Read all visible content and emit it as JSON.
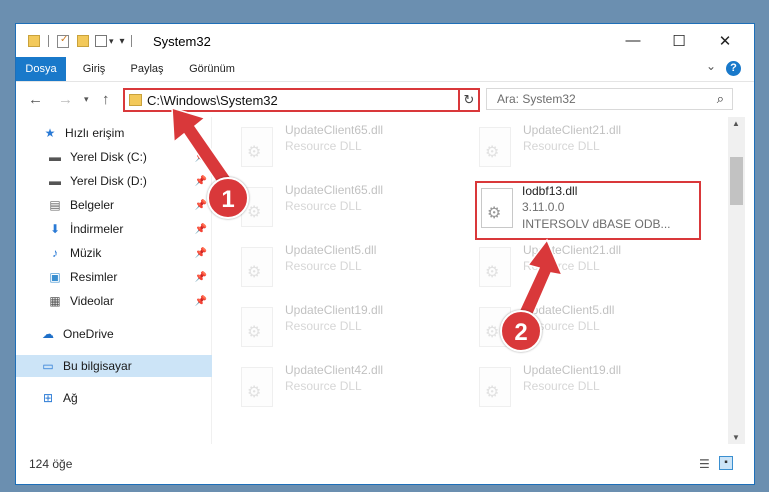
{
  "window": {
    "title": "System32",
    "minimize": "—",
    "maximize": "☐",
    "close": "✕"
  },
  "ribbon": {
    "tabs": [
      "Dosya",
      "Giriş",
      "Paylaş",
      "Görünüm"
    ],
    "collapse": "⌄",
    "help": "?"
  },
  "address": {
    "path": "C:\\Windows\\System32",
    "refresh": "↻",
    "search_placeholder": "Ara: System32"
  },
  "sidebar": {
    "items": [
      {
        "label": "Hızlı erişim",
        "icon": "star-icon",
        "glyph": "★",
        "pinned": false
      },
      {
        "label": "Yerel Disk (C:)",
        "icon": "drive-icon",
        "glyph": "▬",
        "pinned": true
      },
      {
        "label": "Yerel Disk (D:)",
        "icon": "drive-icon",
        "glyph": "▬",
        "pinned": true
      },
      {
        "label": "Belgeler",
        "icon": "document-icon",
        "glyph": "▤",
        "pinned": true
      },
      {
        "label": "İndirmeler",
        "icon": "download-icon",
        "glyph": "⬇",
        "pinned": true
      },
      {
        "label": "Müzik",
        "icon": "music-icon",
        "glyph": "♪",
        "pinned": true
      },
      {
        "label": "Resimler",
        "icon": "pictures-icon",
        "glyph": "▣",
        "pinned": true
      },
      {
        "label": "Videolar",
        "icon": "videos-icon",
        "glyph": "▦",
        "pinned": true
      },
      {
        "label": "OneDrive",
        "icon": "cloud-icon",
        "glyph": "☁",
        "pinned": false
      },
      {
        "label": "Bu bilgisayar",
        "icon": "computer-icon",
        "glyph": "▭",
        "pinned": false
      },
      {
        "label": "Ağ",
        "icon": "network-icon",
        "glyph": "⊞",
        "pinned": false
      }
    ]
  },
  "files": [
    {
      "name": "UpdateClient65.dll",
      "desc": "Resource DLL"
    },
    {
      "name": "UpdateClient21.dll",
      "desc": "Resource DLL"
    },
    {
      "name": "UpdateClient65.dll",
      "desc": "Resource DLL"
    },
    {
      "name": "Iodbf13.dll",
      "version": "3.11.0.0",
      "desc": "INTERSOLV dBASE ODB..."
    },
    {
      "name": "UpdateClient5.dll",
      "desc": "Resource DLL"
    },
    {
      "name": "UpdateClient21.dll",
      "desc": "Resource DLL"
    },
    {
      "name": "UpdateClient19.dll",
      "desc": "Resource DLL"
    },
    {
      "name": "UpdateClient5.dll",
      "desc": "Resource DLL"
    },
    {
      "name": "UpdateClient42.dll",
      "desc": "Resource DLL"
    },
    {
      "name": "UpdateClient19.dll",
      "desc": "Resource DLL"
    }
  ],
  "status": {
    "count": "124 öğe"
  },
  "annotations": {
    "step1": "1",
    "step2": "2",
    "color": "#d9383a"
  }
}
